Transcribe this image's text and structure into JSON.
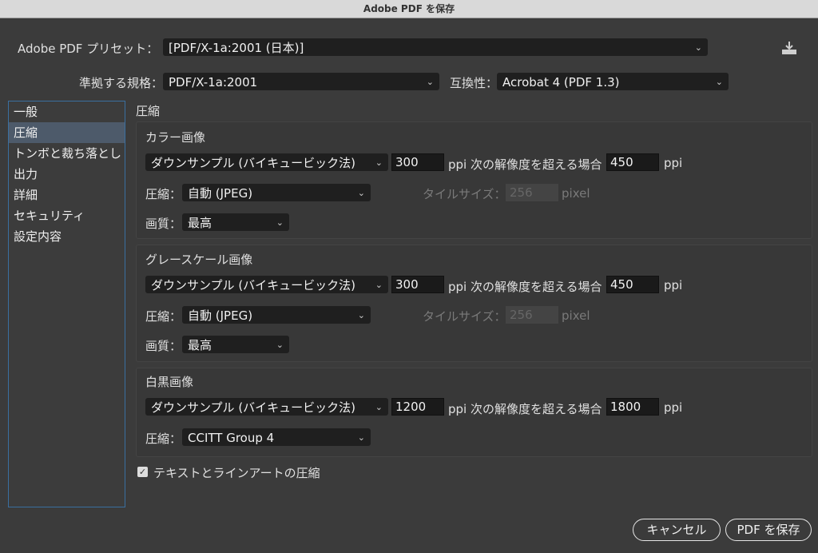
{
  "window": {
    "title": "Adobe PDF を保存"
  },
  "preset": {
    "label": "Adobe PDF プリセット：",
    "value": "[PDF/X-1a:2001 (日本)]"
  },
  "standard": {
    "label": "準拠する規格：",
    "value": "PDF/X-1a:2001"
  },
  "compatibility": {
    "label": "互換性：",
    "value": "Acrobat 4 (PDF 1.3)"
  },
  "sidebar": {
    "items": [
      {
        "label": "一般"
      },
      {
        "label": "圧縮"
      },
      {
        "label": "トンボと裁ち落とし"
      },
      {
        "label": "出力"
      },
      {
        "label": "詳細"
      },
      {
        "label": "セキュリティ"
      },
      {
        "label": "設定内容"
      }
    ],
    "selected_index": 1
  },
  "panel": {
    "title": "圧縮"
  },
  "color": {
    "title": "カラー画像",
    "downsample": "ダウンサンプル (バイキュービック法)",
    "ppi": "300",
    "ppi_unit_text": "ppi 次の解像度を超える場合",
    "threshold": "450",
    "ppi_unit": "ppi",
    "compression_label": "圧縮：",
    "compression": "自動 (JPEG)",
    "tile_label": "タイルサイズ：",
    "tile_value": "256",
    "tile_unit": "pixel",
    "quality_label": "画質：",
    "quality": "最高"
  },
  "gray": {
    "title": "グレースケール画像",
    "downsample": "ダウンサンプル (バイキュービック法)",
    "ppi": "300",
    "ppi_unit_text": "ppi 次の解像度を超える場合",
    "threshold": "450",
    "ppi_unit": "ppi",
    "compression_label": "圧縮：",
    "compression": "自動 (JPEG)",
    "tile_label": "タイルサイズ：",
    "tile_value": "256",
    "tile_unit": "pixel",
    "quality_label": "画質：",
    "quality": "最高"
  },
  "mono": {
    "title": "白黒画像",
    "downsample": "ダウンサンプル (バイキュービック法)",
    "ppi": "1200",
    "ppi_unit_text": "ppi 次の解像度を超える場合",
    "threshold": "1800",
    "ppi_unit": "ppi",
    "compression_label": "圧縮：",
    "compression": "CCITT Group 4"
  },
  "compress_text": {
    "label": "テキストとラインアートの圧縮",
    "checked": true
  },
  "buttons": {
    "cancel": "キャンセル",
    "save": "PDF を保存"
  },
  "icons": {
    "save_preset": "save-preset-icon",
    "chevron": "chevron-down-icon"
  }
}
